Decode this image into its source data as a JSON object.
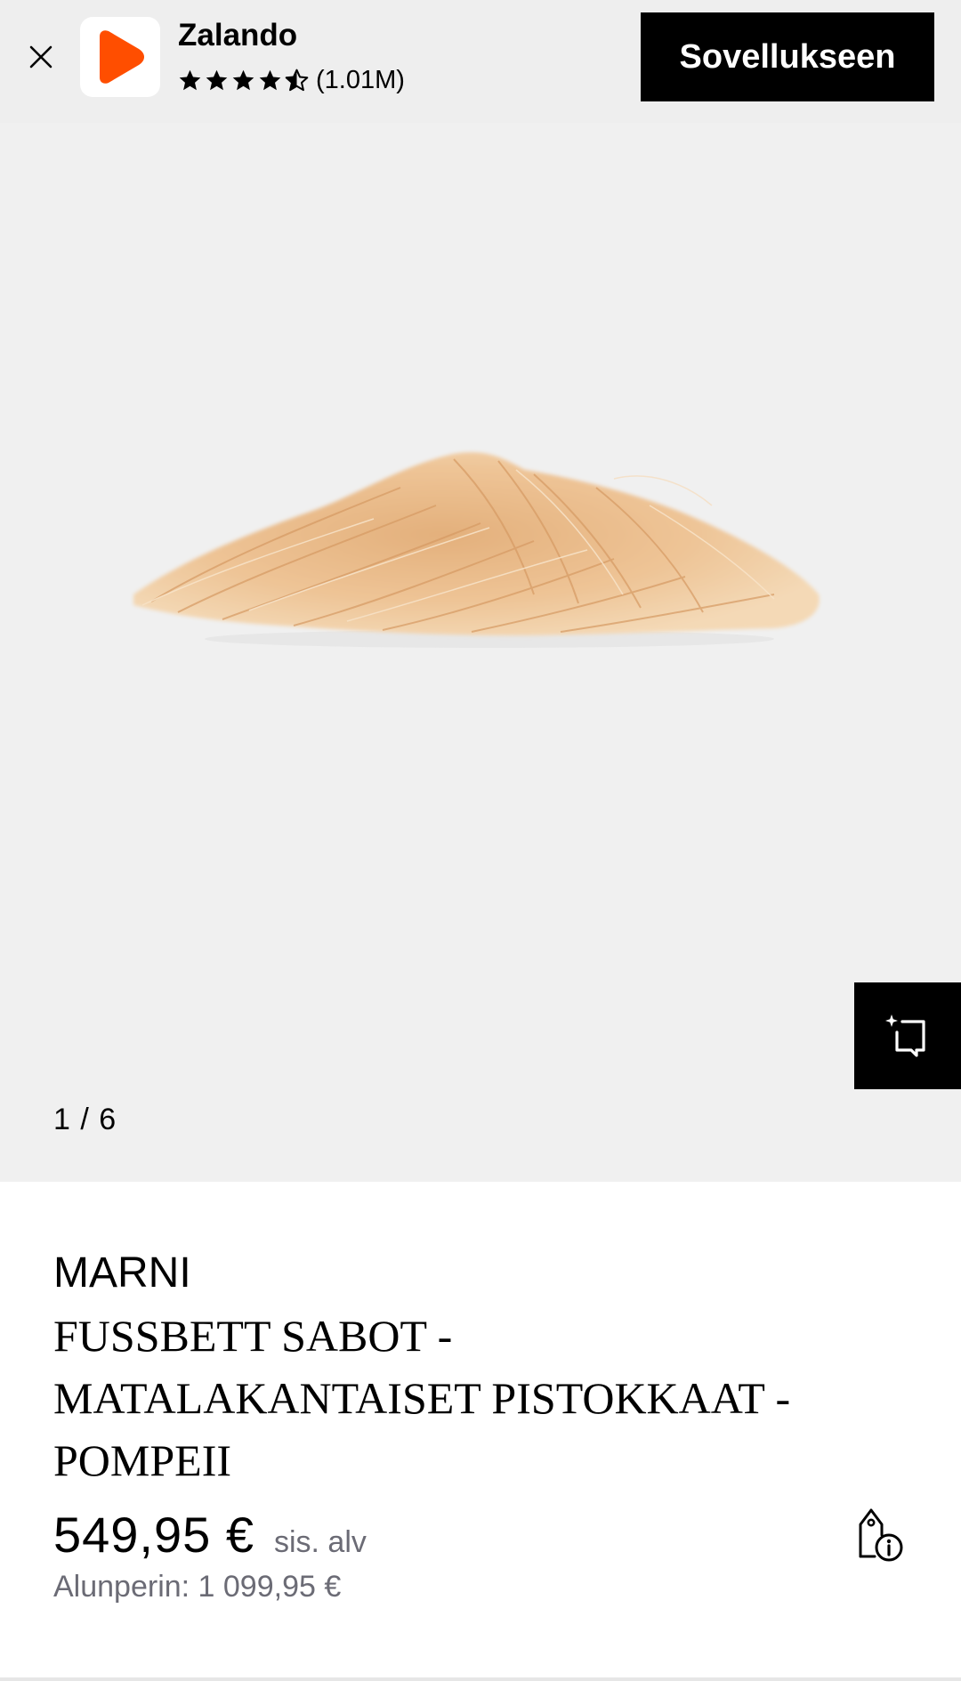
{
  "app_banner": {
    "app_name": "Zalando",
    "rating_stars": 4.5,
    "rating_count": "(1.01M)",
    "open_app_label": "Sovellukseen",
    "logo_color": "#ff4e00"
  },
  "gallery": {
    "counter": "1 / 6",
    "background_color": "#f0f0f0",
    "image_subject": "fluffy blonde fur slipper"
  },
  "product": {
    "brand": "MARNI",
    "title": "FUSSBETT SABOT - MATALAKANTAISET PISTOKKAAT - POMPEII",
    "price": "549,95 €",
    "vat_note": "sis. alv",
    "original_price": "Alunperin: 1 099,95 €"
  },
  "icons": {
    "close": "close-icon",
    "try_on": "try-on-sparkle-icon",
    "price_info": "price-tag-info-icon"
  }
}
